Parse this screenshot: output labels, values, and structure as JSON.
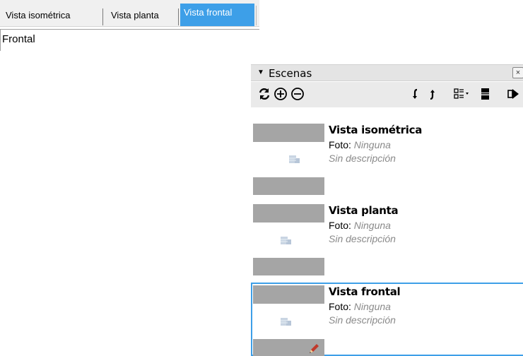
{
  "scene_tabs": [
    {
      "label": "Vista isométrica",
      "active": false
    },
    {
      "label": "Vista planta",
      "active": false
    },
    {
      "label": "Vista frontal",
      "active": true
    }
  ],
  "status_text": "Frontal",
  "panel": {
    "title": "Escenas",
    "collapse_icon": "triangle-down-icon",
    "close_icon": "close-icon",
    "toolbar": [
      "refresh-icon",
      "add-scene-icon",
      "remove-scene-icon",
      "move-scene-down-icon",
      "move-scene-up-icon",
      "view-options-icon",
      "show-details-icon",
      "expand-icon"
    ],
    "photo_label": "Foto:",
    "scenes": [
      {
        "name": "Vista isométrica",
        "photo": "Ninguna",
        "description": "Sin descripción",
        "selected": false
      },
      {
        "name": "Vista planta",
        "photo": "Ninguna",
        "description": "Sin descripción",
        "selected": false
      },
      {
        "name": "Vista frontal",
        "photo": "Ninguna",
        "description": "Sin descripción",
        "selected": true
      }
    ]
  },
  "colors": {
    "accent": "#3d9fe8",
    "thumbnail_gray": "#a5a5a5",
    "muted_text": "#8a8a8a",
    "toolbar_bg": "#eaeaea"
  }
}
